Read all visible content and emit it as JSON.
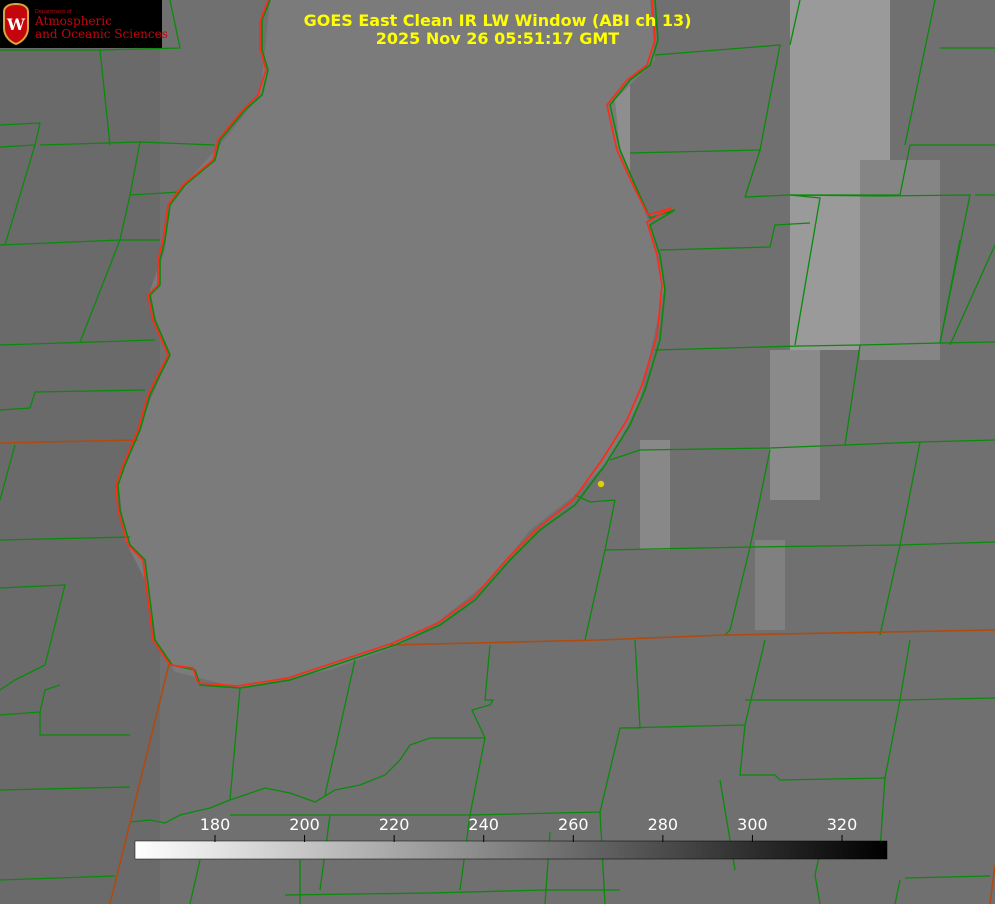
{
  "header": {
    "title": "GOES East Clean IR LW Window (ABI ch 13)",
    "timestamp": "2025 Nov 26 05:51:17 GMT"
  },
  "logo": {
    "department": "Department of",
    "line1": "Atmospheric",
    "line2": "and Oceanic Sciences",
    "seal_letter": "W"
  },
  "colorbar": {
    "ticks": [
      "180",
      "200",
      "220",
      "240",
      "260",
      "280",
      "300",
      "320"
    ],
    "tick_values": [
      180,
      200,
      220,
      240,
      260,
      280,
      300,
      320
    ],
    "gradient": [
      "#ffffff",
      "#000000"
    ]
  },
  "colors": {
    "title": "#ffff00",
    "lake_outline": "#ff2a1a",
    "county_lines": "#0a8a0a",
    "state_lines": "#b04a10",
    "marker": "#e0d000"
  }
}
